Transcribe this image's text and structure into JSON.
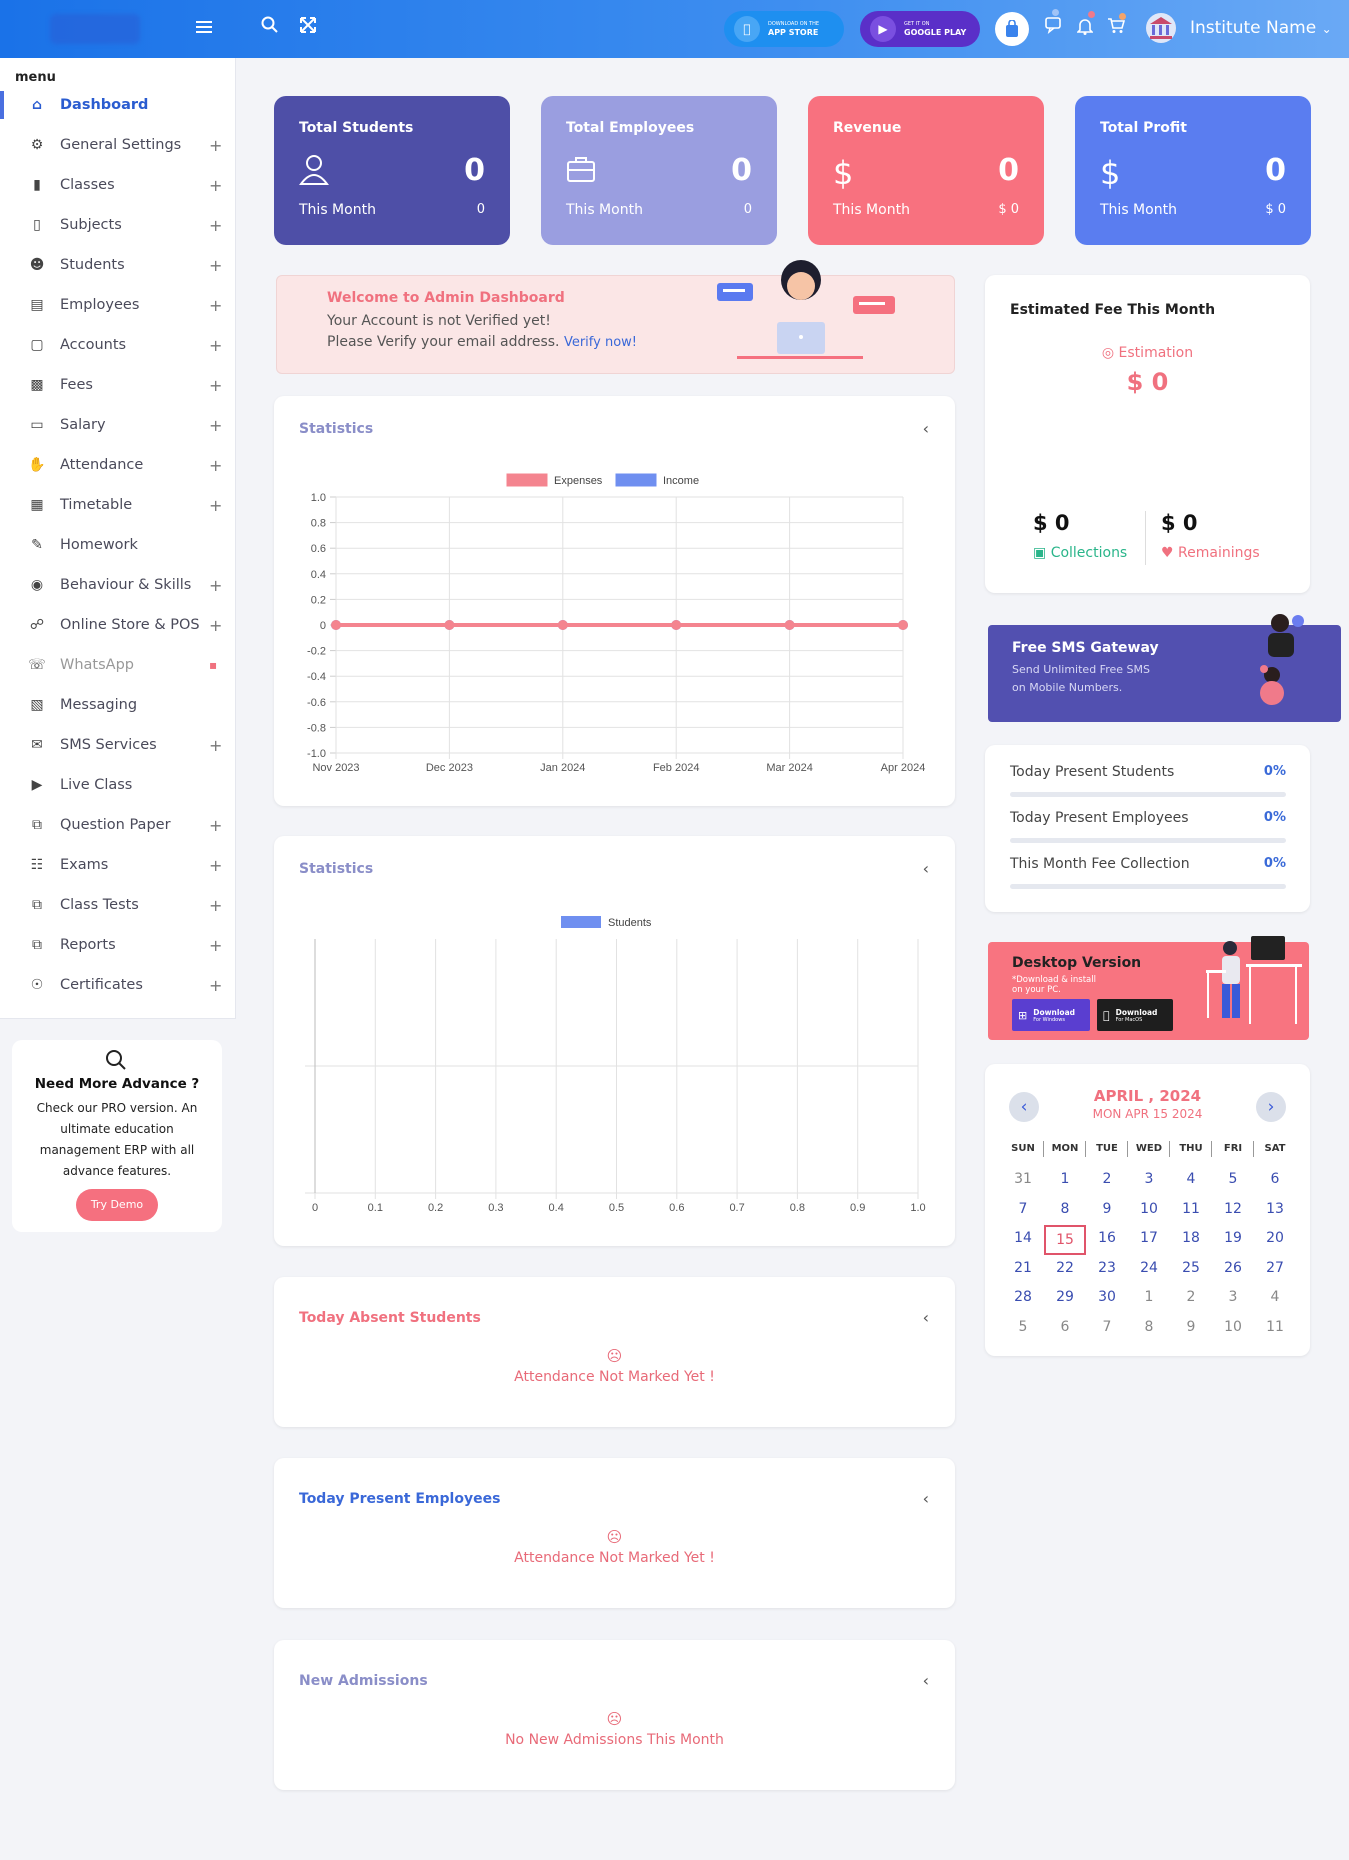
{
  "topbar": {
    "appstore_small": "DOWNLOAD ON THE",
    "appstore_big": "APP STORE",
    "gplay_small": "GET IT ON",
    "gplay_big": "GOOGLE PLAY",
    "institute_name": "Institute Name"
  },
  "sidebar": {
    "menu_label": "menu",
    "items": [
      {
        "label": "Dashboard",
        "icon": "home-icon",
        "expand": false
      },
      {
        "label": "General Settings",
        "icon": "gear-icon",
        "expand": true
      },
      {
        "label": "Classes",
        "icon": "books-icon",
        "expand": true
      },
      {
        "label": "Subjects",
        "icon": "book-icon",
        "expand": true
      },
      {
        "label": "Students",
        "icon": "user-icon",
        "expand": true
      },
      {
        "label": "Employees",
        "icon": "briefcase-icon",
        "expand": true
      },
      {
        "label": "Accounts",
        "icon": "wallet-icon",
        "expand": true
      },
      {
        "label": "Fees",
        "icon": "money-icon",
        "expand": true
      },
      {
        "label": "Salary",
        "icon": "card-icon",
        "expand": true
      },
      {
        "label": "Attendance",
        "icon": "hand-icon",
        "expand": true
      },
      {
        "label": "Timetable",
        "icon": "calendar-icon",
        "expand": true
      },
      {
        "label": "Homework",
        "icon": "pen-icon",
        "expand": false
      },
      {
        "label": "Behaviour & Skills",
        "icon": "eye-icon",
        "expand": true
      },
      {
        "label": "Online Store & POS",
        "icon": "cart-icon",
        "expand": true
      },
      {
        "label": "WhatsApp",
        "icon": "whatsapp-icon",
        "expand": false,
        "locked": true
      },
      {
        "label": "Messaging",
        "icon": "chat-icon",
        "expand": false
      },
      {
        "label": "SMS Services",
        "icon": "mail-icon",
        "expand": true
      },
      {
        "label": "Live Class",
        "icon": "video-icon",
        "expand": false
      },
      {
        "label": "Question Paper",
        "icon": "copy-icon",
        "expand": true
      },
      {
        "label": "Exams",
        "icon": "clipboard-icon",
        "expand": true
      },
      {
        "label": "Class Tests",
        "icon": "copy-icon",
        "expand": true
      },
      {
        "label": "Reports",
        "icon": "copy-icon",
        "expand": true
      },
      {
        "label": "Certificates",
        "icon": "award-icon",
        "expand": true
      }
    ],
    "promo": {
      "title": "Need More Advance ?",
      "text": "Check our PRO version. An ultimate education management ERP with all advance features.",
      "button": "Try Demo"
    }
  },
  "stats": [
    {
      "title": "Total Students",
      "value": "0",
      "month_label": "This Month",
      "month_value": "0",
      "color": "#4e4fa7",
      "icon": "user-icon"
    },
    {
      "title": "Total Employees",
      "value": "0",
      "month_label": "This Month",
      "month_value": "0",
      "color": "#9a9ee0",
      "icon": "briefcase-icon"
    },
    {
      "title": "Revenue",
      "value": "0",
      "month_label": "This Month",
      "month_value": "$ 0",
      "color": "#f8717f",
      "icon": "dollar-icon"
    },
    {
      "title": "Total Profit",
      "value": "0",
      "month_label": "This Month",
      "month_value": "$ 0",
      "color": "#5a7df0",
      "icon": "dollar-icon"
    }
  ],
  "welcome": {
    "title": "Welcome to Admin Dashboard",
    "line1": "Your Account is not Verified yet!",
    "line2": "Please Verify your email address.",
    "link": "Verify now!"
  },
  "chart1": {
    "title": "Statistics"
  },
  "chart2": {
    "title": "Statistics"
  },
  "chart_data": [
    {
      "type": "line",
      "title": "",
      "x": [
        "Nov 2023",
        "Dec 2023",
        "Jan 2024",
        "Feb 2024",
        "Mar 2024",
        "Apr 2024"
      ],
      "series": [
        {
          "name": "Expenses",
          "values": [
            0,
            0,
            0,
            0,
            0,
            0
          ],
          "color": "#f4848f"
        },
        {
          "name": "Income",
          "values": [
            0,
            0,
            0,
            0,
            0,
            0
          ],
          "color": "#6f8ff0"
        }
      ],
      "ylim": [
        -1.0,
        1.0
      ],
      "yticks": [
        "1.0",
        "0.8",
        "0.6",
        "0.4",
        "0.2",
        "0",
        "-0.2",
        "-0.4",
        "-0.6",
        "-0.8",
        "-1.0"
      ],
      "grid": true,
      "legend": "top"
    },
    {
      "type": "bar",
      "title": "",
      "series": [
        {
          "name": "Students",
          "values": [],
          "color": "#6f8ff0"
        }
      ],
      "xlim": [
        0,
        1.0
      ],
      "xticks": [
        "0",
        "0.1",
        "0.2",
        "0.3",
        "0.4",
        "0.5",
        "0.6",
        "0.7",
        "0.8",
        "0.9",
        "1.0"
      ],
      "grid": true,
      "legend": "top"
    }
  ],
  "absent": {
    "title": "Today Absent Students",
    "message": "Attendance Not Marked Yet !"
  },
  "present_emp": {
    "title": "Today Present Employees",
    "message": "Attendance Not Marked Yet !"
  },
  "admissions": {
    "title": "New Admissions",
    "message": "No New Admissions This Month"
  },
  "fee": {
    "title": "Estimated Fee This Month",
    "estimation_label": "Estimation",
    "estimation_value": "$ 0",
    "collections_value": "$ 0",
    "collections_label": "Collections",
    "remainings_value": "$ 0",
    "remainings_label": "Remainings"
  },
  "sms": {
    "title": "Free SMS Gateway",
    "line1": "Send Unlimited Free SMS",
    "line2": "on Mobile Numbers."
  },
  "progress": [
    {
      "label": "Today Present Students",
      "pct": "0%"
    },
    {
      "label": "Today Present Employees",
      "pct": "0%"
    },
    {
      "label": "This Month Fee Collection",
      "pct": "0%"
    }
  ],
  "desktop": {
    "title": "Desktop Version",
    "line1": "*Download & install",
    "line2": "on your PC.",
    "win_btn": "Download",
    "win_sub": "For Windows",
    "mac_btn": "Download",
    "mac_sub": "For MacOS"
  },
  "calendar": {
    "month": "APRIL , 2024",
    "date": "MON APR 15 2024",
    "days": [
      "SUN",
      "MON",
      "TUE",
      "WED",
      "THU",
      "FRI",
      "SAT"
    ],
    "weeks": [
      [
        "31",
        "1",
        "2",
        "3",
        "4",
        "5",
        "6"
      ],
      [
        "7",
        "8",
        "9",
        "10",
        "11",
        "12",
        "13"
      ],
      [
        "14",
        "15",
        "16",
        "17",
        "18",
        "19",
        "20"
      ],
      [
        "21",
        "22",
        "23",
        "24",
        "25",
        "26",
        "27"
      ],
      [
        "28",
        "29",
        "30",
        "1",
        "2",
        "3",
        "4"
      ],
      [
        "5",
        "6",
        "7",
        "8",
        "9",
        "10",
        "11"
      ]
    ],
    "today": "15"
  }
}
